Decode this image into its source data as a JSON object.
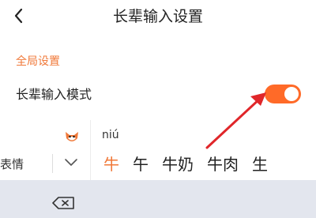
{
  "header": {
    "title": "长辈输入设置"
  },
  "settings": {
    "section_title": "全局设置",
    "elder_mode_label": "长辈输入模式",
    "elder_mode_enabled": true
  },
  "keyboard": {
    "left_label": "表情",
    "pinyin": "niú",
    "candidates": [
      "牛",
      "午",
      "牛奶",
      "牛肉",
      "生"
    ]
  },
  "colors": {
    "accent": "#ff6a28",
    "arrow": "#e0262a",
    "keyboard_bg": "#e3e6ee"
  }
}
